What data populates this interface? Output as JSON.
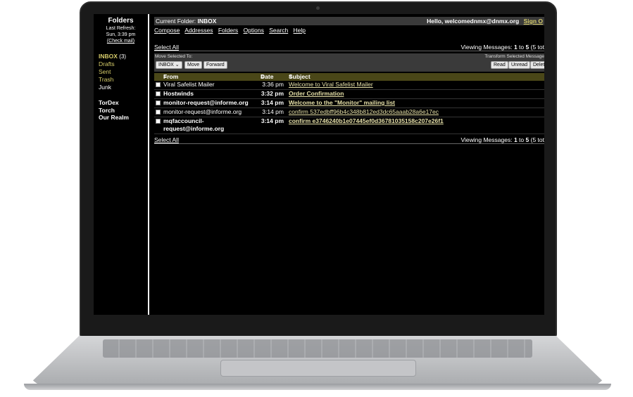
{
  "sidebar": {
    "title": "Folders",
    "refresh_label": "Last Refresh:",
    "refresh_time": "Sun, 3:39 pm",
    "check_mail": "(Check mail)",
    "folders": {
      "inbox": "INBOX",
      "inbox_count": "(3)",
      "drafts": "Drafts",
      "sent": "Sent",
      "trash": "Trash",
      "junk": "Junk"
    },
    "extras": [
      "TorDex",
      "Torch",
      "Our Realm"
    ]
  },
  "header": {
    "current_folder_label": "Current Folder:",
    "current_folder": "INBOX",
    "greeting": "Hello,",
    "user": "welcomednmx@dnmx.org",
    "sign_out": "Sign O"
  },
  "menu": [
    "Compose",
    "Addresses",
    "Folders",
    "Options",
    "Search",
    "Help"
  ],
  "selection": {
    "select_all": "Select All",
    "viewing_label": "Viewing Messages:",
    "from": "1",
    "to_word": "to",
    "to": "5",
    "total": "(5 tot"
  },
  "toolbar": {
    "move_label": "Move Selected To:",
    "move_target": "INBOX",
    "move_button": "Move",
    "forward_button": "Forward",
    "transform_label": "Transform Selected Message",
    "read_button": "Read",
    "unread_button": "Unread",
    "delete_button": "Delet"
  },
  "columns": {
    "from": "From",
    "date": "Date",
    "subject": "Subject"
  },
  "messages": [
    {
      "from": "Viral Safelist Mailer",
      "date": "3:36 pm",
      "subject": "Welcome to Viral Safelist Mailer"
    },
    {
      "from": "Hostwinds",
      "date": "3:32 pm",
      "subject": "Order Confirmation"
    },
    {
      "from": "monitor-request@informe.org",
      "date": "3:14 pm",
      "subject": "Welcome to the \"Monitor\" mailing list"
    },
    {
      "from": "monitor-request@informe.org",
      "date": "3:14 pm",
      "subject": "confirm 537edbff96b4c348b812ed3dc65aaab28a6e17ec"
    },
    {
      "from": "mqfaccouncil-request@informe.org",
      "date": "3:14 pm",
      "subject": "confirm e3746240b1e07445ef0d36781035158c207e26f1"
    }
  ],
  "colors": {
    "accent": "#d6cc6a",
    "header_bar": "#3a3a3a",
    "column_header": "#4a4718",
    "background": "#000000"
  }
}
